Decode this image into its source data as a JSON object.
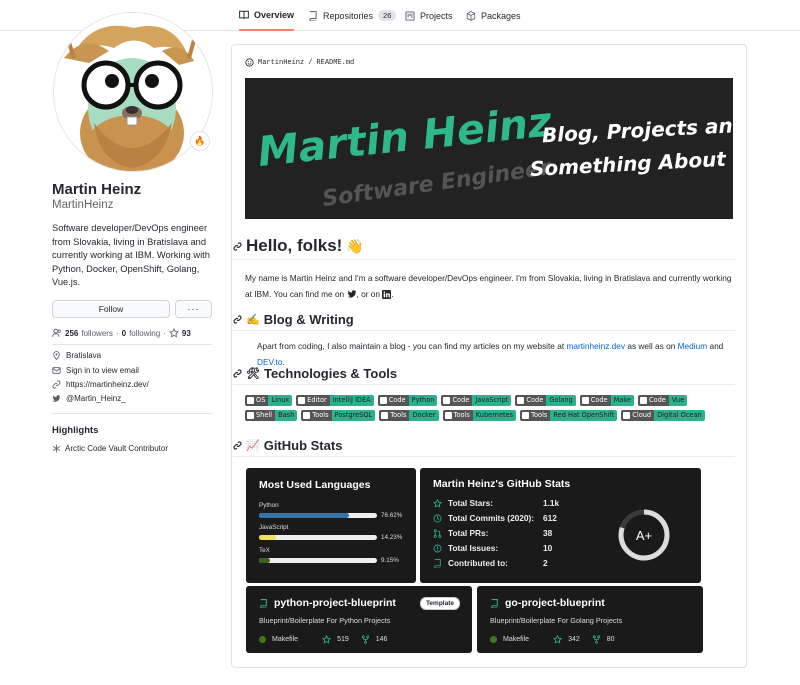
{
  "tabs": [
    {
      "label": "Overview"
    },
    {
      "label": "Repositories",
      "count": "26"
    },
    {
      "label": "Projects"
    },
    {
      "label": "Packages"
    }
  ],
  "profile": {
    "name": "Martin Heinz",
    "login": "MartinHeinz",
    "bio": "Software developer/DevOps engineer from Slovakia, living in Bratislava and currently working at IBM. Working with Python, Docker, OpenShift, Golang, Vue.js.",
    "follow_label": "Follow",
    "more_label": "···",
    "followers_count": "256",
    "followers_label": "followers",
    "following_count": "0",
    "following_label": "following",
    "stars_count": "93",
    "location": "Bratislava",
    "email": "Sign in to view email",
    "website": "https://martinheinz.dev/",
    "twitter": "@Martin_Heinz_",
    "highlights_title": "Highlights",
    "highlight_item": "Arctic Code Vault Contributor"
  },
  "readme": {
    "path_user": "MartinHeinz",
    "path_sep": "/",
    "path_file": "README.md",
    "banner_name": "Martin Heinz",
    "banner_role": "Software Engineer",
    "banner_tag_1": "Blog, Projects and",
    "banner_tag_2": "Something About Me",
    "h_hello": "Hello, folks!",
    "intro_1": "My name is Martin Heinz and I'm a software developer/DevOps engineer. I'm from Slovakia, living in Bratislava and currently working at",
    "intro_2": "IBM. You can find me on",
    "intro_or": ", or on",
    "intro_end": ".",
    "h_blog": "Blog & Writing",
    "blog_pre": "Apart from coding, I also maintain a blog - you can find my articles on my website at",
    "blog_link_site": "martinheinz.dev",
    "blog_mid": "as well as on",
    "blog_link_medium": "Medium",
    "blog_and": "and",
    "blog_link_dev": "DEV.to",
    "blog_end": ".",
    "h_tech": "Technologies & Tools",
    "h_stats": "GitHub Stats"
  },
  "badges": [
    {
      "label": "OS",
      "value": "Linux"
    },
    {
      "label": "Editor",
      "value": "IntelliJ IDEA"
    },
    {
      "label": "Code",
      "value": "Python"
    },
    {
      "label": "Code",
      "value": "JavaScript"
    },
    {
      "label": "Code",
      "value": "Golang"
    },
    {
      "label": "Code",
      "value": "Make"
    },
    {
      "label": "Code",
      "value": "Vue"
    },
    {
      "label": "Shell",
      "value": "Bash"
    },
    {
      "label": "Tools",
      "value": "PostgreSQL"
    },
    {
      "label": "Tools",
      "value": "Docker"
    },
    {
      "label": "Tools",
      "value": "Kubernetes"
    },
    {
      "label": "Tools",
      "value": "Red Hat OpenShift"
    },
    {
      "label": "Cloud",
      "value": "Digital Ocean"
    }
  ],
  "languages_card": {
    "title": "Most Used Languages",
    "langs": [
      {
        "name": "Python",
        "pct": "76.62%",
        "value": 0.7662,
        "color": "#3572A5"
      },
      {
        "name": "JavaScript",
        "pct": "14.23%",
        "value": 0.1423,
        "color": "#f1e05a"
      },
      {
        "name": "TeX",
        "pct": "9.15%",
        "value": 0.0915,
        "color": "#3D6117"
      }
    ]
  },
  "stats_card": {
    "title": "Martin Heinz's GitHub Stats",
    "rows": [
      {
        "label": "Total Stars:",
        "value": "1.1k"
      },
      {
        "label": "Total Commits (2020):",
        "value": "612"
      },
      {
        "label": "Total PRs:",
        "value": "38"
      },
      {
        "label": "Total Issues:",
        "value": "10"
      },
      {
        "label": "Contributed to:",
        "value": "2"
      }
    ],
    "grade": "A+",
    "grade_progress": 0.8
  },
  "repos": [
    {
      "name": "python-project-blueprint",
      "badge": "Template",
      "desc": "Blueprint/Boilerplate For Python Projects",
      "lang": "Makefile",
      "stars": "519",
      "forks": "146"
    },
    {
      "name": "go-project-blueprint",
      "desc": "Blueprint/Boilerplate For Golang Projects",
      "lang": "Makefile",
      "stars": "342",
      "forks": "80"
    }
  ],
  "colors": {
    "accent": "#f9826c",
    "link": "#0366d6",
    "badge_value": "#2ab28e",
    "card_bg": "#1a1a1a",
    "makefile": "#427819"
  }
}
